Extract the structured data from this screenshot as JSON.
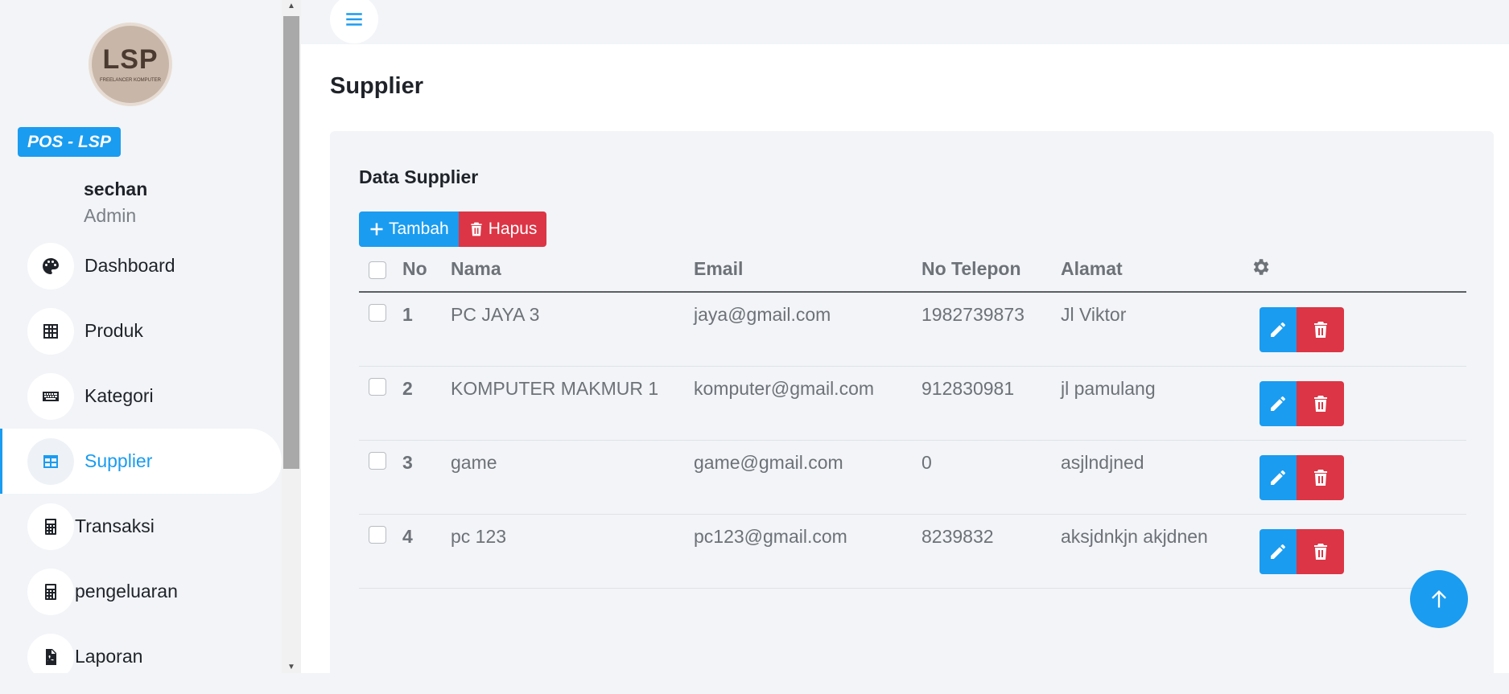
{
  "brand": {
    "logo_text": "LSP",
    "logo_subtitle": "FREELANCER KOMPUTER",
    "badge": "POS - LSP"
  },
  "user": {
    "name": "sechan",
    "role": "Admin"
  },
  "sidebar": {
    "items": [
      {
        "label": "Dashboard",
        "icon": "palette-icon"
      },
      {
        "label": "Produk",
        "icon": "table-icon"
      },
      {
        "label": "Kategori",
        "icon": "keyboard-icon"
      },
      {
        "label": "Supplier",
        "icon": "grid-table-icon",
        "active": true
      },
      {
        "label": "Transaksi",
        "icon": "calculator-icon"
      },
      {
        "label": "pengeluaran",
        "icon": "calculator-icon"
      },
      {
        "label": "Laporan",
        "icon": "pdf-file-icon"
      }
    ]
  },
  "page": {
    "title": "Supplier"
  },
  "card": {
    "title": "Data Supplier",
    "add_label": "Tambah",
    "delete_label": "Hapus"
  },
  "table": {
    "headers": {
      "no": "No",
      "nama": "Nama",
      "email": "Email",
      "telepon": "No Telepon",
      "alamat": "Alamat",
      "actions": "gear-icon"
    },
    "rows": [
      {
        "no": "1",
        "nama": "PC JAYA 3",
        "email": "jaya@gmail.com",
        "telepon": "1982739873",
        "alamat": "Jl Viktor"
      },
      {
        "no": "2",
        "nama": "KOMPUTER MAKMUR 1",
        "email": "komputer@gmail.com",
        "telepon": "912830981",
        "alamat": "jl pamulang"
      },
      {
        "no": "3",
        "nama": "game",
        "email": "game@gmail.com",
        "telepon": "0",
        "alamat": "asjlndjned"
      },
      {
        "no": "4",
        "nama": "pc 123",
        "email": "pc123@gmail.com",
        "telepon": "8239832",
        "alamat": "aksjdnkjn akjdnen"
      }
    ]
  },
  "colors": {
    "primary": "#1a9cf0",
    "danger": "#dc3545",
    "background": "#f2f4f7"
  }
}
